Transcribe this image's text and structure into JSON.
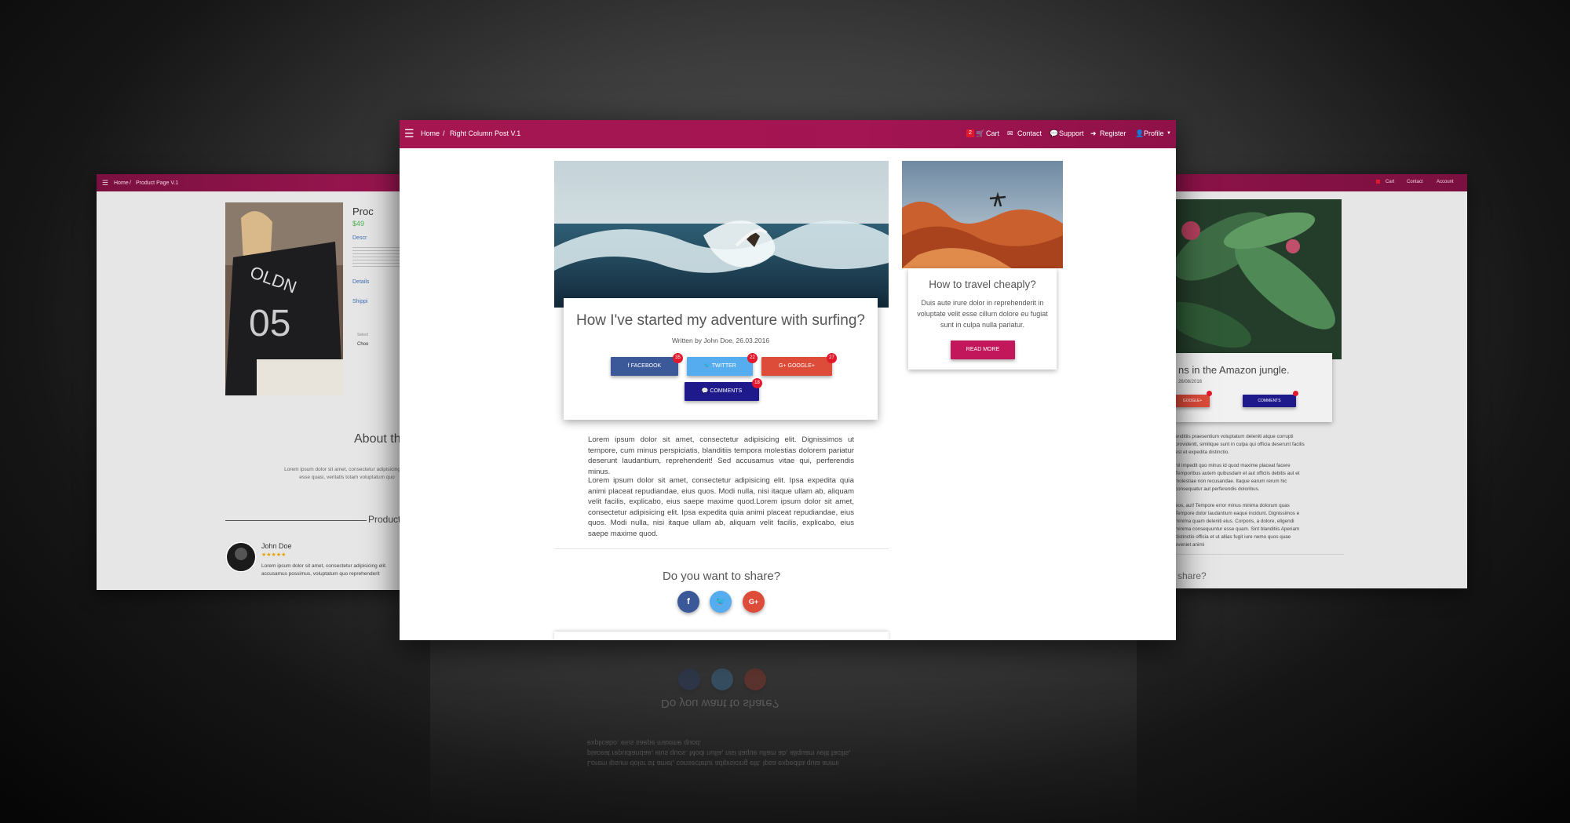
{
  "main": {
    "nav": {
      "home": "Home",
      "sep": "/",
      "page": "Right Column Post V.1",
      "cart_count": "2",
      "cart": "Cart",
      "contact": "Contact",
      "support": "Support",
      "register": "Register",
      "profile": "Profile"
    },
    "post": {
      "title": "How I've started my adventure with surfing?",
      "meta": "Written by John Doe, 26.03.2016",
      "buttons": {
        "facebook": "FACEBOOK",
        "twitter": "TWITTER",
        "google": "GOOGLE+",
        "comments": "COMMENTS"
      },
      "counts": {
        "facebook": "35",
        "twitter": "22",
        "google": "27",
        "comments": "18"
      },
      "para1": "Lorem ipsum dolor sit amet, consectetur adipisicing elit. Dignissimos ut tempore, cum minus perspiciatis, blanditiis tempora molestias dolorem pariatur deserunt laudantium, reprehenderit! Sed accusamus vitae qui, perferendis minus.",
      "para2": "Lorem ipsum dolor sit amet, consectetur adipisicing elit. Ipsa expedita quia animi placeat repudiandae, eius quos. Modi nulla, nisi itaque ullam ab, aliquam velit facilis, explicabo, eius saepe maxime quod.Lorem ipsum dolor sit amet, consectetur adipisicing elit. Ipsa expedita quia animi placeat repudiandae, eius quos. Modi nulla, nisi itaque ullam ab, aliquam velit facilis, explicabo, eius saepe maxime quod.",
      "share_heading": "Do you want to share?",
      "share_icons": {
        "facebook": "f",
        "google": "G+"
      }
    },
    "sidebar": {
      "title": "How to travel cheaply?",
      "text": "Duis aute irure dolor in reprehenderit in voluptate velit esse cillum dolore eu fugiat sunt in culpa nulla pariatur.",
      "button": "READ MORE"
    }
  },
  "left": {
    "nav": {
      "home": "Home",
      "sep": "/",
      "page": "Product Page V.1"
    },
    "product_title": "Proc",
    "price": "$49",
    "tab_desc": "Descr",
    "tab_details": "Details",
    "tab_shipping": "Shippi",
    "select_label": "Select",
    "select_value": "Choo",
    "about": "About th",
    "about_text": "Lorem ipsum dolor sit amet, consectetur adipisicing elit. esse quasi, veritatis totam voluptatum quo",
    "products_heading": "Product",
    "review": {
      "name": "John Doe",
      "stars": "★★★★★",
      "text": "Lorem ipsum dolor sit amet, consectetur adipisicing elit. accusamus possimus, voluptatum quo reprehenderit"
    }
  },
  "right": {
    "nav": {
      "cart": "Cart",
      "contact": "Contact",
      "account": "Account"
    },
    "title": "ns in the Amazon jungle.",
    "date": "26/08/2016",
    "google": "GOOGLE+",
    "comments": "COMMENTS",
    "p1": "anditiis praesentium voluptatum deleniti atque corrupti providentt, similique sunt in culpa qui officia deserunt facilis est et expedita distinctio.",
    "p2": "hil impedit quo minus id quod maxime placeat facere Temporibus autem quibusdam et aut officiis debitis aut et molestiae non recusandae. Itaque earum rerum hic consequatur aut perferendis doloribus.",
    "p3": "eos, aut! Tempore error minus minima dolorum quas Tempore dolor laudantium eaque incidunt. Dignissimos e minima quam deleniti eius. Corporis, a dolore, eligendi minima consequuntur esse quam. Sint blanditiis Aperiam distinctio officia et ut allias fugit iure nemo quos quae eveniet animi",
    "share": "share?"
  },
  "reflection": {
    "heading": "Do you want to share?",
    "text": "Lorem ipsum dolor sit amet, consectetur adipisicing elit. Ipsa expedita quia animi placeat repudiandae, eius quos. Modi nulla, nisi itaque ullam ab, aliquam velit facilis, explicabo, eius saepe maxime quod."
  },
  "colors": {
    "brand": "#a51650",
    "facebook": "#3b5998",
    "twitter": "#55acee",
    "google": "#dd4b39",
    "comments": "#1f1a8c",
    "read_more": "#c2185b"
  }
}
